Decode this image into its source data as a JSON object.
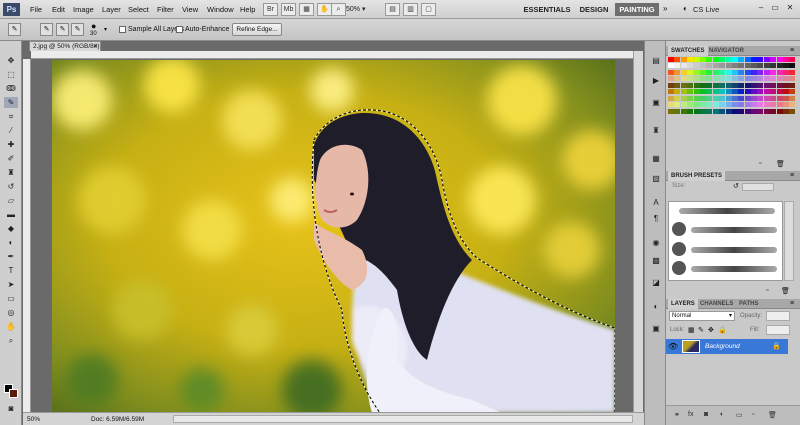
{
  "menubar": {
    "logo": "Ps",
    "menus": [
      "File",
      "Edit",
      "Image",
      "Layer",
      "Select",
      "Filter",
      "View",
      "Window",
      "Help"
    ],
    "zoom": "50%",
    "workspaces": [
      "ESSENTIALS",
      "DESIGN",
      "PAINTING"
    ],
    "active_workspace": "PAINTING",
    "cs_live": "CS Live"
  },
  "options": {
    "brush_size": "30",
    "sample_all_layers": "Sample All Layers",
    "auto_enhance": "Auto-Enhance",
    "refine_edge": "Refine Edge..."
  },
  "document": {
    "tab_title": "2.jpg @ 50% (RGB/8#)",
    "status_zoom": "50%",
    "status_doc": "Doc: 6.59M/6.59M"
  },
  "panels": {
    "swatches_tab": "SWATCHES",
    "navigator_tab": "NAVIGATOR",
    "brush_presets_tab": "BRUSH PRESETS",
    "brush_size_label": "Size:",
    "layers_tab": "LAYERS",
    "channels_tab": "CHANNELS",
    "paths_tab": "PATHS",
    "blend_mode": "Normal",
    "opacity_label": "Opacity:",
    "lock_label": "Lock:",
    "fill_label": "Fill:",
    "layer_name": "Background"
  },
  "colors": {
    "foreground": "#000000",
    "background": "#5a1a0a",
    "selected_layer": "#3a78d8"
  }
}
